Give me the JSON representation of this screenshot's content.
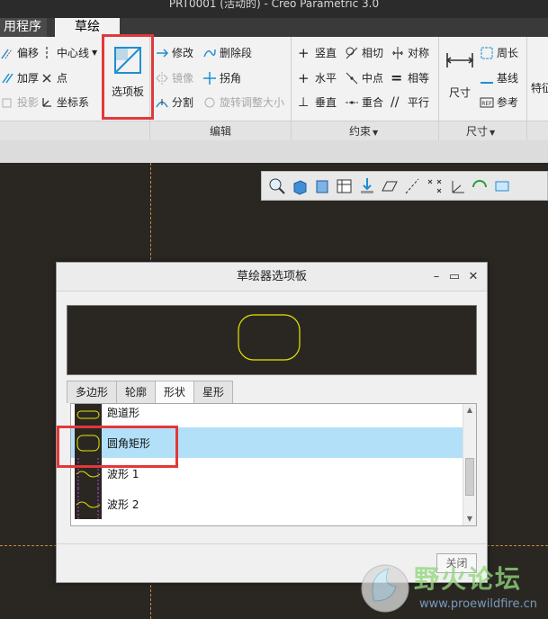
{
  "window": {
    "title": "PRT0001 (活动的) - Creo Parametric 3.0"
  },
  "ribbon_tabs": {
    "app": "用程序",
    "sketch": "草绘"
  },
  "ribbon": {
    "setup": {
      "offset": "偏移",
      "thicken": "加厚",
      "project": "投影",
      "centerline": "中心线",
      "point": "点",
      "csys": "坐标系"
    },
    "palette_label": "选项板",
    "editing": {
      "modify": "修改",
      "mirror": "镜像",
      "divide": "分割",
      "delete_segment": "删除段",
      "corner": "拐角",
      "rotate_resize": "旋转调整大小",
      "group": "编辑"
    },
    "constrain": {
      "vertical": "竖直",
      "horizontal": "水平",
      "perpendicular": "垂直",
      "tangent": "相切",
      "midpoint": "中点",
      "coincident": "重合",
      "symmetric": "对称",
      "equal": "相等",
      "parallel": "平行",
      "group": "约束"
    },
    "dimension": {
      "normal": "尺寸",
      "perimeter": "周长",
      "baseline": "基线",
      "reference": "参考",
      "group": "尺寸"
    },
    "more": "特征"
  },
  "dialog": {
    "title": "草绘器选项板",
    "tabs": [
      "多边形",
      "轮廓",
      "形状",
      "星形"
    ],
    "active_tab": "形状",
    "items": [
      {
        "label": "跑道形"
      },
      {
        "label": "圆角矩形"
      },
      {
        "label": "波形 1"
      },
      {
        "label": "波形 2"
      }
    ],
    "selected_item": "圆角矩形",
    "close_label": "关闭"
  },
  "watermark": {
    "title": "野火论坛",
    "url": "www.proewildfire.cn"
  },
  "colors": {
    "accent": "#1e8fd0",
    "highlight_box": "#e2383a",
    "sketch_line": "#e6e600",
    "selection": "#b3e0f9",
    "graphics_bg": "#2a2723"
  }
}
